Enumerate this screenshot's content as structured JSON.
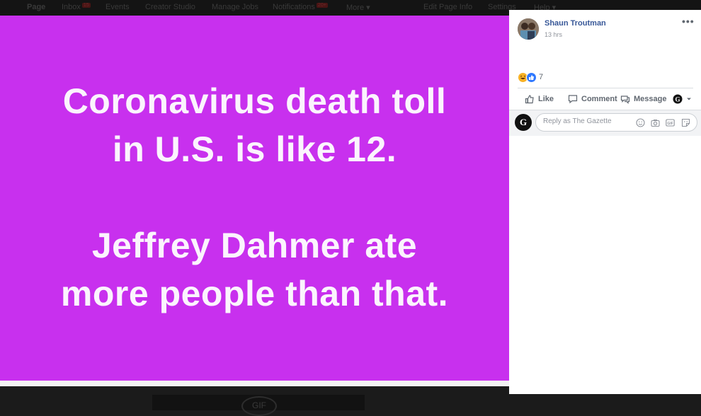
{
  "topbar": {
    "items": [
      {
        "label": "Page"
      },
      {
        "label": "Inbox",
        "badge": "15"
      },
      {
        "label": "Events"
      },
      {
        "label": "Creator Studio"
      },
      {
        "label": "Manage Jobs"
      },
      {
        "label": "Notifications",
        "badge": "20+"
      },
      {
        "label": "More ▾"
      },
      {
        "label": "Edit Page Info"
      },
      {
        "label": "Settings"
      },
      {
        "label": "Help ▾"
      }
    ]
  },
  "photo": {
    "lines": [
      "Coronavirus death toll",
      "in U.S. is like 12.",
      "Jeffrey Dahmer ate",
      "more people than that."
    ],
    "background_color": "#c830ee",
    "text_color": "#fbf4fd"
  },
  "bottom": {
    "gif_label": "GIF"
  },
  "post": {
    "author": "Shaun Troutman",
    "time": "13 hrs",
    "more_icon": "more-horizontal-icon",
    "reactions": {
      "icons": [
        "haha-reaction-icon",
        "like-reaction-icon"
      ],
      "count": "7"
    },
    "actions": {
      "like": "Like",
      "comment": "Comment",
      "message": "Message"
    },
    "reply": {
      "placeholder": "Reply as The Gazette",
      "page_logo_letter": "G",
      "icons": [
        "emoji-icon",
        "camera-icon",
        "gif-icon",
        "sticker-icon"
      ]
    },
    "link_color": "#385898"
  }
}
